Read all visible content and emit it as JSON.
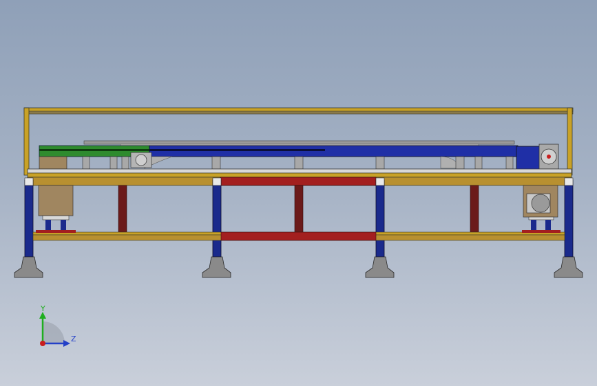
{
  "viewport": {
    "background_top": "#8fa0b8",
    "background_bottom": "#c9cfda"
  },
  "model": {
    "description_colors": {
      "frame_gold": "#c9a227",
      "leg_blue": "#1a2a8c",
      "crossbar_red": "#8c1a1a",
      "belt_green": "#2e8b2e",
      "belt_blue": "#1f2fa6",
      "motor_box": "#a08660",
      "foot_grey": "#8a8a8a"
    }
  },
  "triad": {
    "y_label": "Y",
    "z_label": "Z",
    "y_color": "#1fae1f",
    "z_color": "#2340c8",
    "x_color": "#c81e1e"
  }
}
